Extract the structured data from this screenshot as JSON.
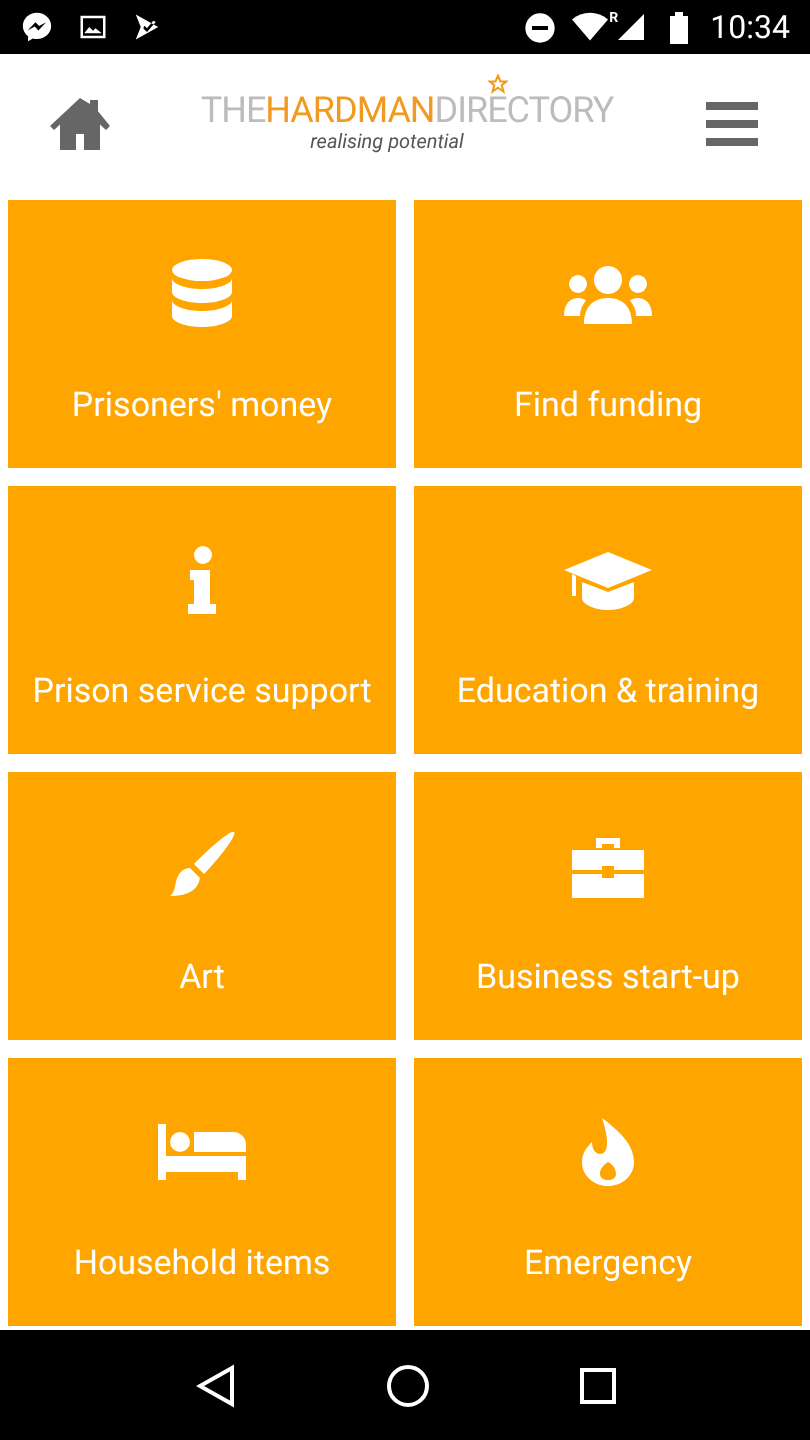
{
  "status_bar": {
    "roaming": "R",
    "time": "10:34"
  },
  "header": {
    "logo": {
      "prefix": "THE",
      "highlight": "HARDMAN",
      "suffix": "DIRECTORY",
      "tagline": "realising potential"
    }
  },
  "tiles": [
    {
      "label": "Prisoners' money",
      "kind": "coins"
    },
    {
      "label": "Find funding",
      "kind": "people"
    },
    {
      "label": "Prison service support",
      "kind": "info"
    },
    {
      "label": "Education & training",
      "kind": "graduation"
    },
    {
      "label": "Art",
      "kind": "brush"
    },
    {
      "label": "Business start-up",
      "kind": "briefcase"
    },
    {
      "label": "Household items",
      "kind": "bed"
    },
    {
      "label": "Emergency",
      "kind": "flame"
    }
  ]
}
